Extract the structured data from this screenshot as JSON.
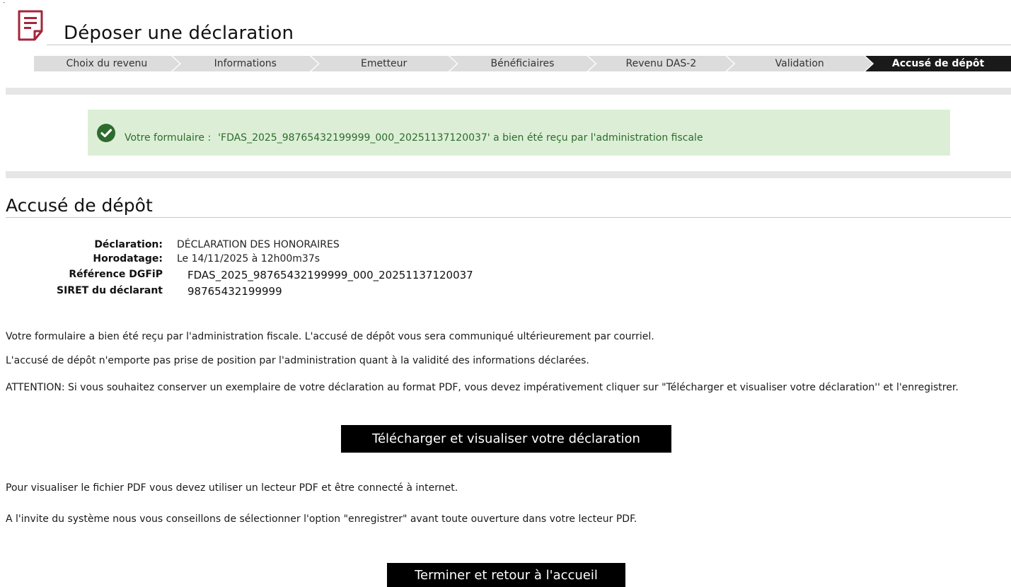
{
  "header": {
    "title": "Déposer une déclaration"
  },
  "steps": [
    "Choix du revenu",
    "Informations",
    "Emetteur",
    "Bénéficiaires",
    "Revenu DAS-2",
    "Validation",
    "Accusé de dépôt"
  ],
  "active_step": "Accusé de dépôt",
  "alert": {
    "label": "Votre formulaire :",
    "message": "'FDAS_2025_98765432199999_000_20251137120037' a bien été reçu par l'administration fiscale",
    "color": "#dcefd6"
  },
  "section": {
    "title": "Accusé de dépôt"
  },
  "info": {
    "declaration_label": "Déclaration:",
    "declaration_value": "DÉCLARATION DES HONORAIRES",
    "horodatage_label": "Horodatage:",
    "horodatage_value": "Le 14/11/2025 à 12h00m37s",
    "reference_label": "Référence DGFiP",
    "reference_value": "FDAS_2025_98765432199999_000_20251137120037",
    "siret_label": "SIRET du déclarant",
    "siret_value": "98765432199999"
  },
  "paragraphs": {
    "p1": "Votre formulaire a bien été reçu par l'administration fiscale. L'accusé de dépôt vous sera communiqué ultérieurement par courriel.",
    "p2": "L'accusé de dépôt n'emporte pas prise de position par l'administration quant à la validité des informations déclarées.",
    "p3": "ATTENTION: Si vous souhaitez conserver un exemplaire de votre déclaration au format PDF, vous devez impérativement cliquer sur \"Télécharger et visualiser votre déclaration'' et l'enregistrer.",
    "p4": "Pour visualiser le fichier PDF vous devez utiliser un lecteur PDF et être connecté à internet.",
    "p5": "A l'invite du système nous vous conseillons de sélectionner l'option \"enregistrer\" avant toute ouverture dans votre lecteur PDF."
  },
  "buttons": {
    "download": "Télécharger et visualiser votre déclaration",
    "finish": "Terminer et retour à l'accueil"
  },
  "colors": {
    "brand": "#a3263b",
    "success": "#2e6b2e",
    "step_bg": "#dcdcdc",
    "step_active": "#1a1a1a"
  }
}
